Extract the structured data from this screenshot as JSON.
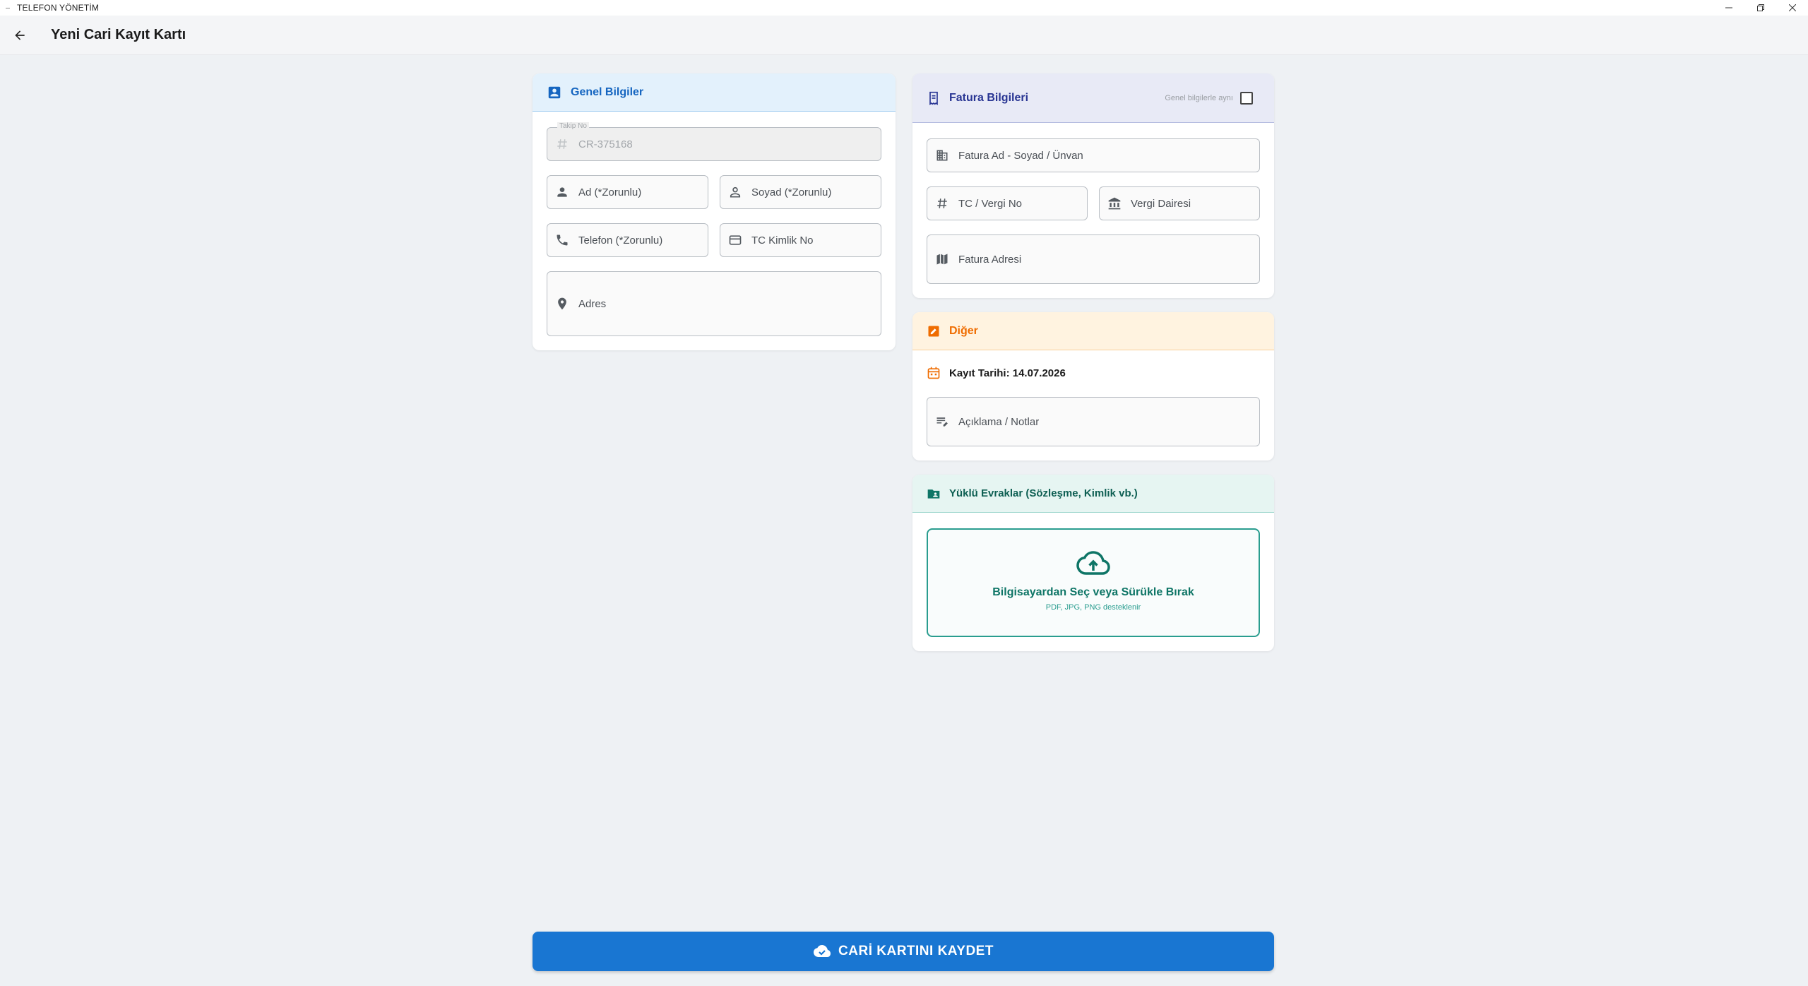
{
  "window": {
    "title": "TELEFON YÖNETİM"
  },
  "appbar": {
    "title": "Yeni Cari Kayıt Kartı"
  },
  "general": {
    "title": "Genel Bilgiler",
    "tracking_label": "Takip No",
    "tracking_value": "CR-375168",
    "first_name": "Ad (*Zorunlu)",
    "last_name": "Soyad (*Zorunlu)",
    "phone": "Telefon (*Zorunlu)",
    "tc_id": "TC Kimlik No",
    "address": "Adres"
  },
  "invoice": {
    "title": "Fatura Bilgileri",
    "same_as_general": "Genel bilgilerle aynı",
    "same_checked": false,
    "name": "Fatura Ad - Soyad / Ünvan",
    "tax_no": "TC / Vergi No",
    "tax_office": "Vergi Dairesi",
    "address": "Fatura Adresi"
  },
  "other": {
    "title": "Diğer",
    "registration_date": "Kayıt Tarihi: 14.07.2026",
    "notes": "Açıklama / Notlar"
  },
  "documents": {
    "title": "Yüklü Evraklar (Sözleşme, Kimlik vb.)",
    "upload_text": "Bilgisayardan Seç veya Sürükle Bırak",
    "upload_hint": "PDF, JPG, PNG desteklenir"
  },
  "save_button": {
    "label": "CARİ KARTINI KAYDET"
  },
  "colors": {
    "primary": "#1976d2",
    "general_head": "#e3f1fc",
    "invoice_head": "#e8eaf6",
    "other_head": "#fff3e0",
    "docs_head": "#e6f5f2",
    "other_accent": "#ef6c00",
    "docs_accent": "#0e7566"
  }
}
